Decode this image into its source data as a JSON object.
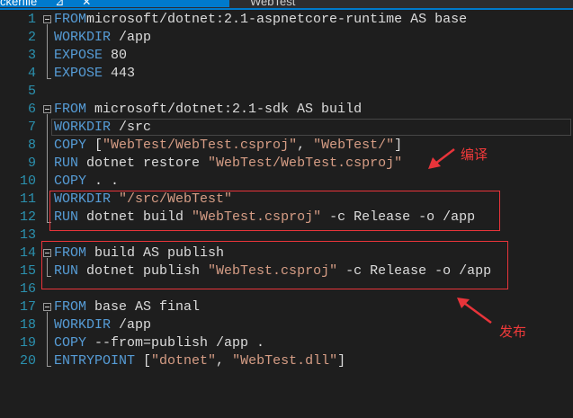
{
  "tabs": [
    {
      "label": "ckerfile",
      "active": true
    },
    {
      "label": "WebTest",
      "active": false
    }
  ],
  "tab_icons": {
    "pin": "⊿",
    "close": "✕"
  },
  "lines": [
    {
      "n": "1",
      "fold": true,
      "tokens": [
        [
          "kw",
          "FROM"
        ],
        [
          "",
          "microsoft/dotnet:2.1-aspnetcore-runtime AS base"
        ]
      ]
    },
    {
      "n": "2",
      "tokens": [
        [
          "kw",
          "WORKDIR"
        ],
        [
          "",
          " /app"
        ]
      ]
    },
    {
      "n": "3",
      "tokens": [
        [
          "kw",
          "EXPOSE"
        ],
        [
          "",
          " 80"
        ]
      ]
    },
    {
      "n": "4",
      "tokens": [
        [
          "kw",
          "EXPOSE"
        ],
        [
          "",
          " 443"
        ]
      ]
    },
    {
      "n": "5",
      "tokens": []
    },
    {
      "n": "6",
      "fold": true,
      "tokens": [
        [
          "kw",
          "FROM"
        ],
        [
          "",
          " microsoft/dotnet:2.1-sdk AS build"
        ]
      ]
    },
    {
      "n": "7",
      "current": true,
      "tokens": [
        [
          "kw",
          "WORKDIR"
        ],
        [
          "",
          " /src"
        ]
      ]
    },
    {
      "n": "8",
      "tokens": [
        [
          "kw",
          "COPY"
        ],
        [
          "",
          " ["
        ],
        [
          "str",
          "\"WebTest/WebTest.csproj\""
        ],
        [
          "",
          ", "
        ],
        [
          "str",
          "\"WebTest/\""
        ],
        [
          "",
          "]"
        ]
      ]
    },
    {
      "n": "9",
      "tokens": [
        [
          "kw",
          "RUN"
        ],
        [
          "",
          " dotnet restore "
        ],
        [
          "str",
          "\"WebTest/WebTest.csproj\""
        ]
      ]
    },
    {
      "n": "10",
      "tokens": [
        [
          "kw",
          "COPY"
        ],
        [
          "",
          " . ."
        ]
      ]
    },
    {
      "n": "11",
      "tokens": [
        [
          "kw",
          "WORKDIR"
        ],
        [
          "",
          " "
        ],
        [
          "str",
          "\"/src/WebTest\""
        ]
      ]
    },
    {
      "n": "12",
      "tokens": [
        [
          "kw",
          "RUN"
        ],
        [
          "",
          " dotnet build "
        ],
        [
          "str",
          "\"WebTest.csproj\""
        ],
        [
          "",
          " -c Release -o /app"
        ]
      ]
    },
    {
      "n": "13",
      "tokens": []
    },
    {
      "n": "14",
      "fold": true,
      "tokens": [
        [
          "kw",
          "FROM"
        ],
        [
          "",
          " build AS publish"
        ]
      ]
    },
    {
      "n": "15",
      "tokens": [
        [
          "kw",
          "RUN"
        ],
        [
          "",
          " dotnet publish "
        ],
        [
          "str",
          "\"WebTest.csproj\""
        ],
        [
          "",
          " -c Release -o /app"
        ]
      ]
    },
    {
      "n": "16",
      "tokens": []
    },
    {
      "n": "17",
      "fold": true,
      "tokens": [
        [
          "kw",
          "FROM"
        ],
        [
          "",
          " base AS final"
        ]
      ]
    },
    {
      "n": "18",
      "tokens": [
        [
          "kw",
          "WORKDIR"
        ],
        [
          "",
          " /app"
        ]
      ]
    },
    {
      "n": "19",
      "tokens": [
        [
          "kw",
          "COPY"
        ],
        [
          "",
          " --from=publish /app ."
        ]
      ]
    },
    {
      "n": "20",
      "tokens": [
        [
          "kw",
          "ENTRYPOINT"
        ],
        [
          "",
          " ["
        ],
        [
          "str",
          "\"dotnet\""
        ],
        [
          "",
          ", "
        ],
        [
          "str",
          "\"WebTest.dll\""
        ],
        [
          "",
          "]"
        ]
      ]
    }
  ],
  "annotations": {
    "build": "编译",
    "publish": "发布"
  },
  "colors": {
    "annotation": "#e8343a",
    "keyword": "#569cd6",
    "string": "#d69d85"
  }
}
